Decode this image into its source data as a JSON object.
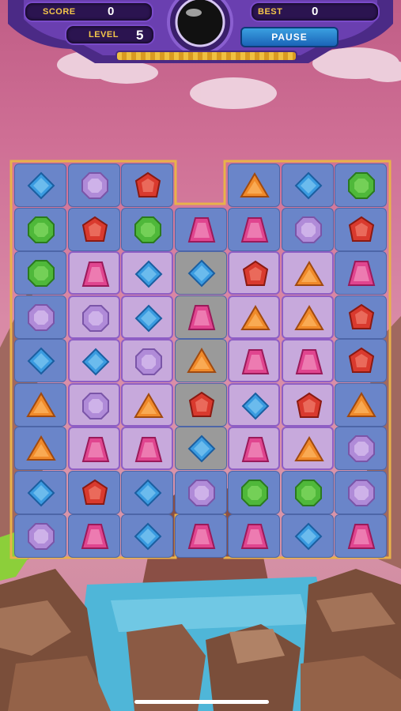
{
  "hud": {
    "score_label": "SCORE",
    "score_value": "0",
    "best_label": "BEST",
    "best_value": "0",
    "level_label": "LEVEL",
    "level_value": "5",
    "pause_label": "PAUSE",
    "level_progress": 1.0
  },
  "board": {
    "columns": 7,
    "rows": 9,
    "empty_cells": [
      [
        0,
        3
      ]
    ],
    "stone_column": 3,
    "stone_rows": [
      2,
      3,
      4,
      5,
      6
    ],
    "highlighted_area": {
      "rows": [
        2,
        6
      ],
      "cols": [
        1,
        5
      ]
    },
    "grid": [
      [
        "blue-diamond",
        "purple-octagon",
        "red-gem",
        null,
        "orange-triangle",
        "blue-diamond",
        "green-octagon"
      ],
      [
        "green-octagon",
        "red-gem",
        "green-octagon",
        "pink-bag",
        "pink-bag",
        "purple-octagon",
        "red-gem"
      ],
      [
        "green-octagon",
        "pink-bag",
        "blue-diamond",
        "blue-diamond",
        "red-gem",
        "orange-triangle",
        "pink-bag"
      ],
      [
        "purple-octagon",
        "purple-octagon",
        "blue-diamond",
        "pink-bag",
        "orange-triangle",
        "orange-triangle",
        "red-gem"
      ],
      [
        "blue-diamond",
        "blue-diamond",
        "purple-octagon",
        "orange-triangle",
        "pink-bag",
        "pink-bag",
        "red-gem"
      ],
      [
        "orange-triangle",
        "purple-octagon",
        "orange-triangle",
        "red-gem",
        "blue-diamond",
        "red-gem",
        "orange-triangle"
      ],
      [
        "orange-triangle",
        "pink-bag",
        "pink-bag",
        "blue-diamond",
        "pink-bag",
        "orange-triangle",
        "purple-octagon"
      ],
      [
        "blue-diamond",
        "red-gem",
        "blue-diamond",
        "purple-octagon",
        "green-octagon",
        "green-octagon",
        "purple-octagon"
      ],
      [
        "purple-octagon",
        "pink-bag",
        "blue-diamond",
        "pink-bag",
        "pink-bag",
        "blue-diamond",
        "pink-bag"
      ]
    ]
  },
  "colors": {
    "blue-diamond": "#3a9be0",
    "purple-octagon": "#b08bd8",
    "red-gem": "#d93a2e",
    "orange-triangle": "#f08a2a",
    "green-octagon": "#4fb83a",
    "pink-bag": "#e0458f",
    "cell": "#6a85c9",
    "highlight": "#c7a9dc",
    "stone": "#9a9a9a",
    "frame": "#e8b24a"
  }
}
